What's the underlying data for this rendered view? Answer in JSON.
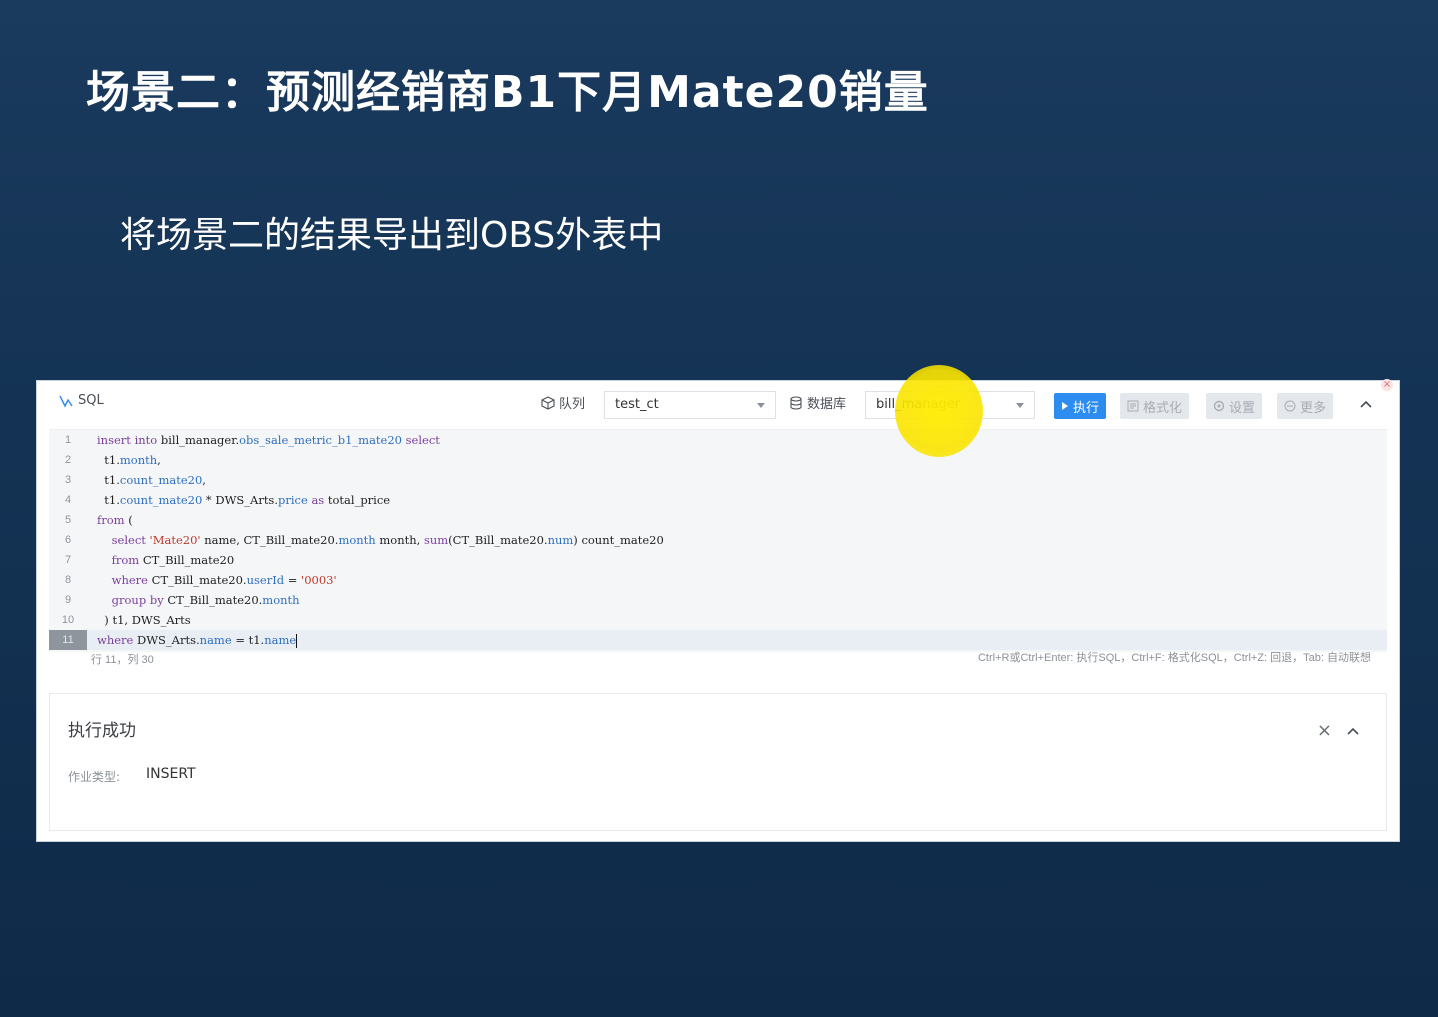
{
  "slide": {
    "title": "场景二：预测经销商B1下月Mate20销量",
    "subtitle": "将场景二的结果导出到OBS外表中"
  },
  "toolbar": {
    "sql_label": "SQL",
    "queue_label": "队列",
    "queue_value": "test_ct",
    "database_label": "数据库",
    "database_value": "bill_manager",
    "execute_label": "执行",
    "format_label": "格式化",
    "settings_label": "设置",
    "more_label": "更多"
  },
  "editor": {
    "lines": [
      {
        "n": "1",
        "segments": [
          [
            "kw",
            "insert "
          ],
          [
            "kw",
            "into "
          ],
          [
            "",
            "bill_manager."
          ],
          [
            "id",
            "obs_sale_metric_b1_mate20 "
          ],
          [
            "kw",
            "select"
          ]
        ]
      },
      {
        "n": "2",
        "segments": [
          [
            "",
            "  t1."
          ],
          [
            "id",
            "month"
          ],
          [
            "",
            ","
          ]
        ]
      },
      {
        "n": "3",
        "segments": [
          [
            "",
            "  t1."
          ],
          [
            "id",
            "count_mate20"
          ],
          [
            "",
            ","
          ]
        ]
      },
      {
        "n": "4",
        "segments": [
          [
            "",
            "  t1."
          ],
          [
            "id",
            "count_mate20"
          ],
          [
            "",
            " * DWS_Arts."
          ],
          [
            "id",
            "price "
          ],
          [
            "kw",
            "as "
          ],
          [
            "",
            "total_price"
          ]
        ]
      },
      {
        "n": "5",
        "segments": [
          [
            "kw",
            "from "
          ],
          [
            "",
            "("
          ]
        ]
      },
      {
        "n": "6",
        "segments": [
          [
            "",
            "    "
          ],
          [
            "kw",
            "select "
          ],
          [
            "str",
            "'Mate20' "
          ],
          [
            "",
            "name, CT_Bill_mate20."
          ],
          [
            "id",
            "month "
          ],
          [
            "",
            "month, "
          ],
          [
            "kw",
            "sum"
          ],
          [
            "",
            "(CT_Bill_mate20."
          ],
          [
            "id",
            "num"
          ],
          [
            "",
            ") count_mate20"
          ]
        ]
      },
      {
        "n": "7",
        "segments": [
          [
            "",
            "    "
          ],
          [
            "kw",
            "from "
          ],
          [
            "",
            "CT_Bill_mate20"
          ]
        ]
      },
      {
        "n": "8",
        "segments": [
          [
            "",
            "    "
          ],
          [
            "kw",
            "where "
          ],
          [
            "",
            "CT_Bill_mate20."
          ],
          [
            "id",
            "userId "
          ],
          [
            "",
            "= "
          ],
          [
            "str",
            "'0003'"
          ]
        ]
      },
      {
        "n": "9",
        "segments": [
          [
            "",
            "    "
          ],
          [
            "kw",
            "group by "
          ],
          [
            "",
            "CT_Bill_mate20."
          ],
          [
            "id",
            "month"
          ]
        ]
      },
      {
        "n": "10",
        "segments": [
          [
            "",
            "  ) t1, DWS_Arts"
          ]
        ]
      },
      {
        "n": "11",
        "segments": [
          [
            "kw",
            "where "
          ],
          [
            "",
            "DWS_Arts."
          ],
          [
            "id",
            "name "
          ],
          [
            "",
            "= t1."
          ],
          [
            "id",
            "name"
          ]
        ]
      }
    ],
    "cursor_position": "行 11，列 30",
    "shortcuts_hint": "Ctrl+R或Ctrl+Enter: 执行SQL，Ctrl+F: 格式化SQL，Ctrl+Z: 回退，Tab: 自动联想"
  },
  "result": {
    "title": "执行成功",
    "job_type_label": "作业类型:",
    "job_type_value": "INSERT"
  },
  "colors": {
    "background": "#143354",
    "accent": "#2d8cf0",
    "keyword": "#7b3f9e",
    "identifier": "#2e6fbf",
    "string": "#c0392b",
    "cursor_highlight": "#ffec00"
  }
}
